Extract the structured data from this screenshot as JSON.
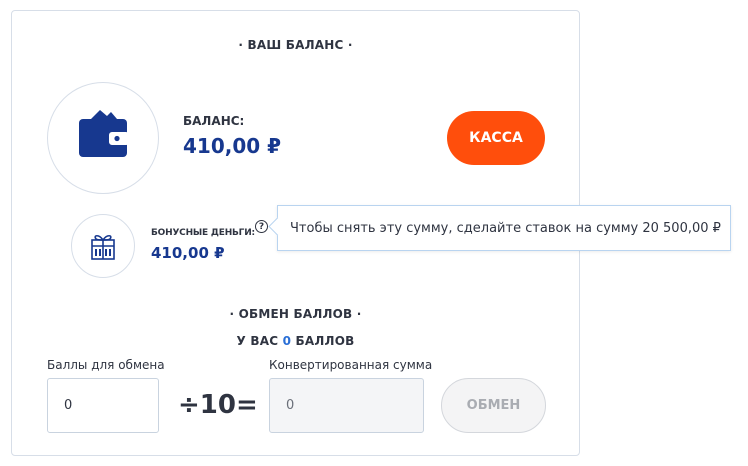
{
  "balance_section": {
    "title": "· ВАШ БАЛАНС ·",
    "balance_label": "БАЛАНС:",
    "balance_value": "410,00 ₽",
    "cashier_button": "КАССА",
    "bonus_label": "БОНУСНЫЕ ДЕНЬГИ:",
    "bonus_value": "410,00 ₽",
    "help_icon": "?",
    "tooltip": "Чтобы снять эту сумму, сделайте ставок на сумму 20 500,00 ₽"
  },
  "exchange_section": {
    "title": "· ОБМЕН БАЛЛОВ ·",
    "points_prefix": "У ВАС",
    "points_count": "0",
    "points_suffix": "БАЛЛОВ",
    "points_field_label": "Баллы для обмена",
    "points_field_value": "0",
    "operator": "÷10=",
    "converted_label": "Конвертированная сумма",
    "converted_value": "0",
    "exchange_button": "ОБМЕН"
  },
  "colors": {
    "accent_blue": "#17388f",
    "cashier_orange": "#ff4e0c",
    "points_count_blue": "#2a6fd6"
  },
  "icons": [
    "wallet-icon",
    "gift-icon",
    "help-icon"
  ]
}
